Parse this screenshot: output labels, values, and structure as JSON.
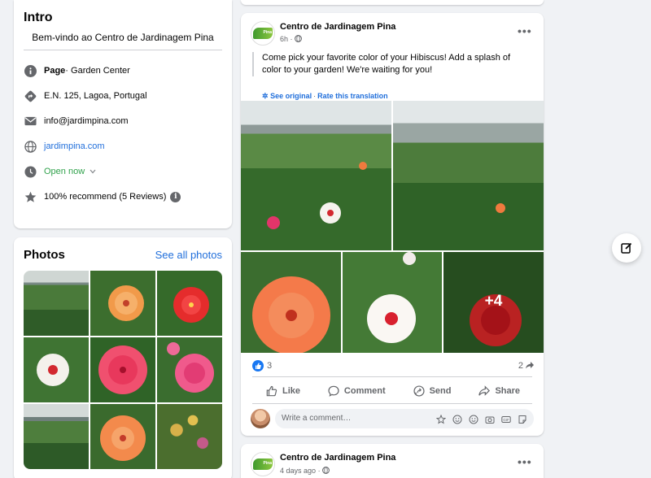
{
  "intro": {
    "title": "Intro",
    "bio": "Bem-vindo ao Centro de Jardinagem Pina",
    "page_label": "Page",
    "page_category": " · Garden Center",
    "address": "E.N. 125, Lagoa, Portugal",
    "email": "info@jardimpina.com",
    "website": "jardimpina.com",
    "hours": "Open now",
    "rating": "100% recommend (5 Reviews)",
    "info_glyph": "i"
  },
  "photos": {
    "title": "Photos",
    "see_all": "See all photos"
  },
  "post": {
    "author": "Centro de Jardinagem Pina",
    "time": "6h",
    "logo_text": "Pina",
    "text": "Come pick your favorite color of your Hibiscus! Add a splash of color to your garden! We're waiting for you!",
    "see_original": "See original",
    "rate_translation": "Rate this translation",
    "more_count": "+4",
    "like_count": "3",
    "share_count": "2",
    "actions": {
      "like": "Like",
      "comment": "Comment",
      "send": "Send",
      "share": "Share"
    },
    "comment_placeholder": "Write a comment…"
  },
  "post2": {
    "author": "Centro de Jardinagem Pina",
    "time": "4 days ago",
    "logo_text": "Pina"
  },
  "colors": {
    "link": "#216fdb",
    "green": "#31a24c",
    "like_blue": "#1877f2",
    "background": "#f0f2f5"
  },
  "icons": [
    "info-icon",
    "directions-icon",
    "mail-icon",
    "globe-icon",
    "clock-icon",
    "star-icon",
    "globe-small-icon",
    "like-icon",
    "comment-icon",
    "messenger-icon",
    "share-icon",
    "edit-icon",
    "more-icon"
  ]
}
